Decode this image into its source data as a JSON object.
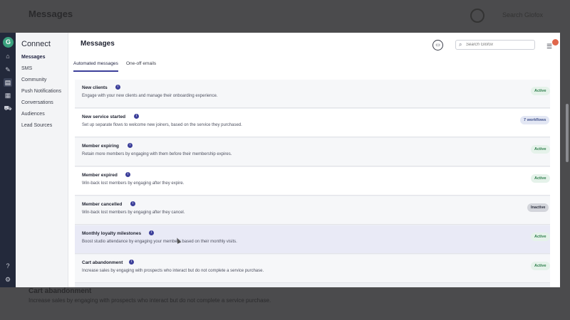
{
  "backdrop": {
    "title": "Messages",
    "search_placeholder": "Search Glofox",
    "row_title": "Cart abandonment",
    "row_desc": "Increase sales by engaging with prospects who interact but do not complete a service purchase."
  },
  "rail": {
    "logo": "G",
    "icons": [
      "home-icon",
      "tools-icon",
      "messages-icon",
      "reports-icon",
      "cart-icon",
      "help-icon",
      "gear-icon"
    ]
  },
  "subnav": {
    "title": "Connect",
    "items": [
      "Messages",
      "SMS",
      "Community",
      "Push Notifications",
      "Conversations",
      "Audiences",
      "Lead Sources"
    ]
  },
  "header": {
    "title": "Messages",
    "search_placeholder": "Search Glofox"
  },
  "tabs": [
    "Automated messages",
    "One-off emails"
  ],
  "rows": [
    {
      "title": "New clients",
      "desc": "Engage with your new clients and manage their onboarding experience.",
      "status": "Active"
    },
    {
      "title": "New service started",
      "desc": "Set up separate flows to welcome new joiners, based on the service they purchased.",
      "status": "7 workflows"
    },
    {
      "title": "Member expiring",
      "desc": "Retain more members by engaging with them before their membership expires.",
      "status": "Active"
    },
    {
      "title": "Member expired",
      "desc": "Win-back lost members by engaging after they expire.",
      "status": "Active"
    },
    {
      "title": "Member cancelled",
      "desc": "Win-back lost members by engaging after they cancel.",
      "status": "Inactive"
    },
    {
      "title": "Monthly loyalty milestones",
      "desc": "Boost studio attendance by engaging your members based on their monthly visits.",
      "status": "Active"
    },
    {
      "title": "Cart abandonment",
      "desc": "Increase sales by engaging with prospects who interact but do not complete a service purchase.",
      "status": "Active"
    }
  ],
  "colors": {
    "accent": "#3c3f9a",
    "rail": "#23293b",
    "active_badge": "#2d7d4b",
    "notification": "#e0664b"
  }
}
